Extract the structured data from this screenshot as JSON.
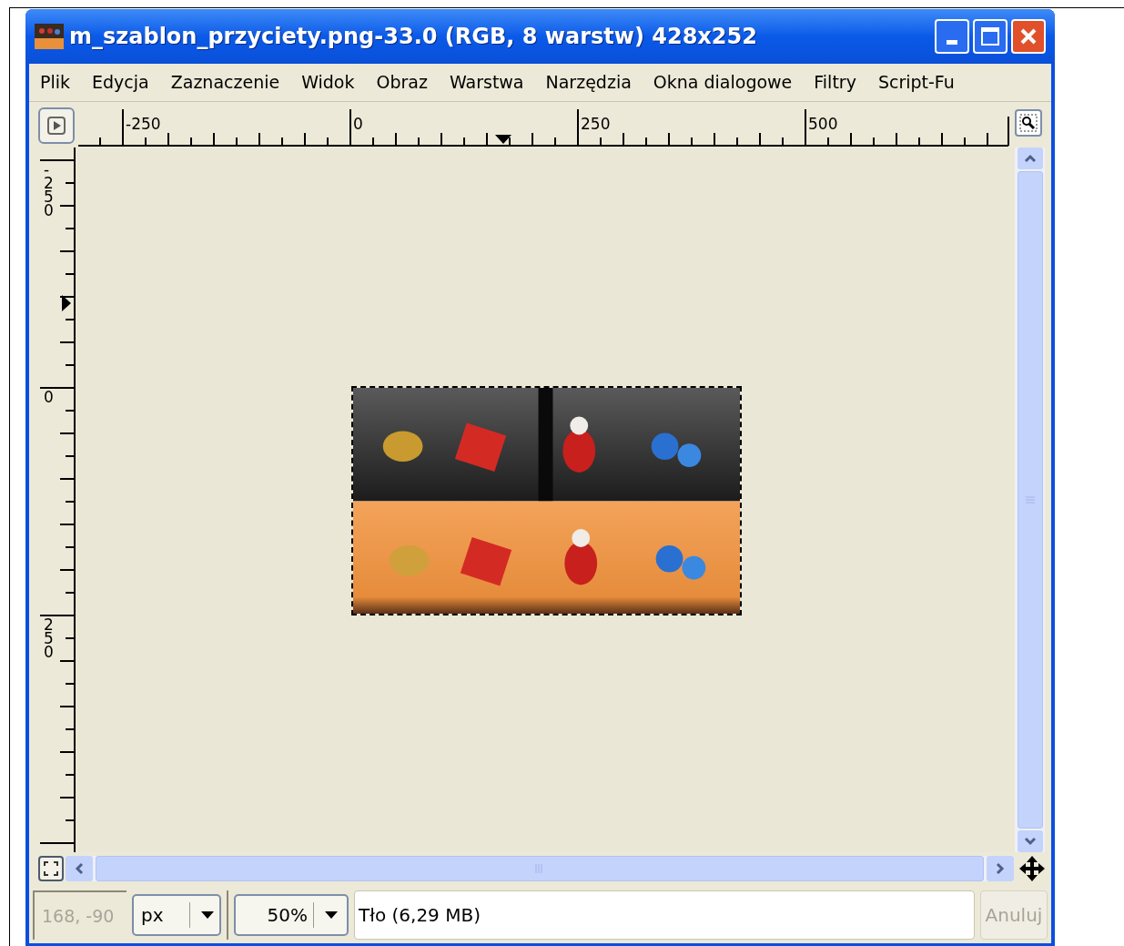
{
  "window": {
    "title": "m_szablon_przyciety.png-33.0 (RGB, 8 warstw) 428x252"
  },
  "menu": [
    {
      "label": "Plik"
    },
    {
      "label": "Edycja"
    },
    {
      "label": "Zaznaczenie"
    },
    {
      "label": "Widok"
    },
    {
      "label": "Obraz"
    },
    {
      "label": "Warstwa"
    },
    {
      "label": "Narzędzia"
    },
    {
      "label": "Okna dialogowe"
    },
    {
      "label": "Filtry"
    },
    {
      "label": "Script-Fu"
    }
  ],
  "rulers": {
    "horizontal": [
      "-250",
      "0",
      "250",
      "500"
    ],
    "vertical": [
      "-250",
      "0",
      "250"
    ]
  },
  "status_bar": {
    "coordinates": "168, -90",
    "unit": "px",
    "zoom": "50%",
    "message": "Tło (6,29 MB)",
    "cancel": {
      "label": "Anuluj",
      "disabled": true
    }
  }
}
